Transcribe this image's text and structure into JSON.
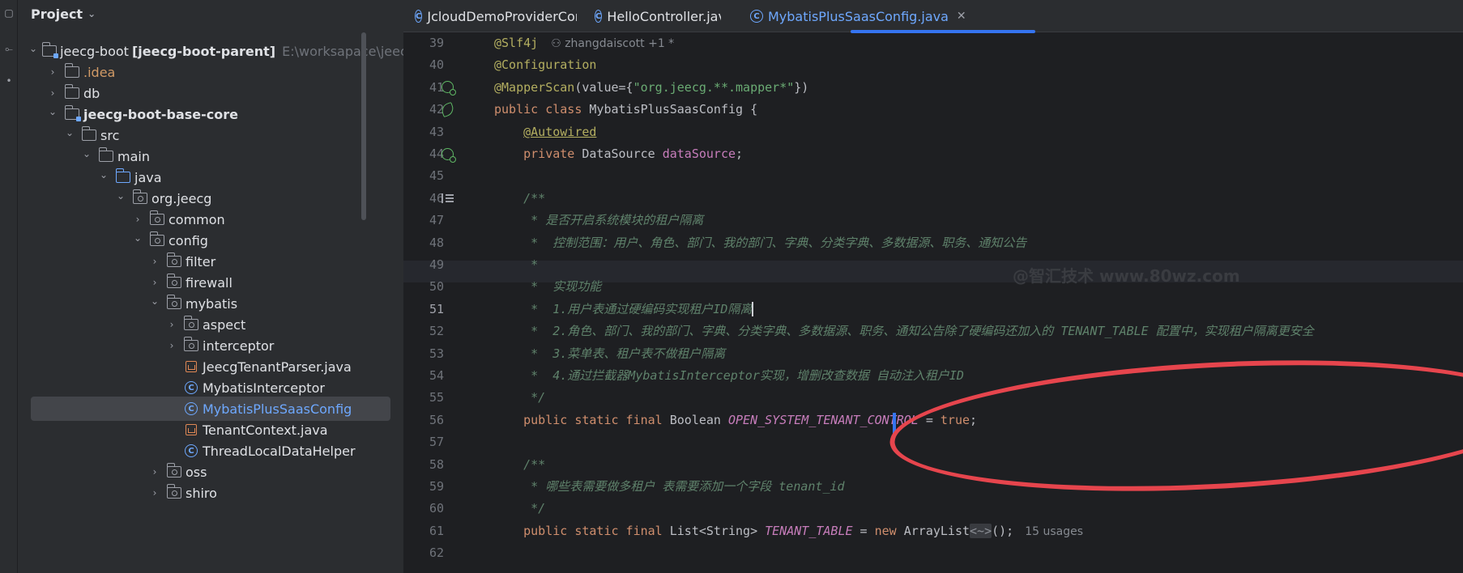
{
  "project_panel": {
    "title": "Project",
    "tree": [
      {
        "label": "jeecg-boot",
        "suffix": "[jeecg-boot-parent]",
        "path": "E:\\worksapace\\jeecg\\je",
        "icon": "module-folder-icon",
        "depth": 1,
        "expanded": true
      },
      {
        "label": ".idea",
        "icon": "folder-icon",
        "depth": 2,
        "expanded": false,
        "color": "orange"
      },
      {
        "label": "db",
        "icon": "folder-icon",
        "depth": 2,
        "expanded": false
      },
      {
        "label": "jeecg-boot-base-core",
        "icon": "module-folder-icon",
        "depth": 2,
        "expanded": true,
        "bold": true
      },
      {
        "label": "src",
        "icon": "folder-icon",
        "depth": 3,
        "expanded": true
      },
      {
        "label": "main",
        "icon": "folder-icon",
        "depth": 4,
        "expanded": true
      },
      {
        "label": "java",
        "icon": "source-folder-icon",
        "depth": 5,
        "expanded": true
      },
      {
        "label": "org.jeecg",
        "icon": "package-icon",
        "depth": 6,
        "expanded": true
      },
      {
        "label": "common",
        "icon": "package-icon",
        "depth": 7,
        "expanded": false
      },
      {
        "label": "config",
        "icon": "package-icon",
        "depth": 7,
        "expanded": true
      },
      {
        "label": "filter",
        "icon": "package-icon",
        "depth": 8,
        "expanded": false
      },
      {
        "label": "firewall",
        "icon": "package-icon",
        "depth": 8,
        "expanded": false
      },
      {
        "label": "mybatis",
        "icon": "package-icon",
        "depth": 8,
        "expanded": true
      },
      {
        "label": "aspect",
        "icon": "package-icon",
        "depth": 9,
        "expanded": false
      },
      {
        "label": "interceptor",
        "icon": "package-icon",
        "depth": 9,
        "expanded": false
      },
      {
        "label": "JeecgTenantParser.java",
        "icon": "java-file-icon",
        "depth": 9
      },
      {
        "label": "MybatisInterceptor",
        "icon": "class-icon",
        "depth": 9
      },
      {
        "label": "MybatisPlusSaasConfig",
        "icon": "class-icon",
        "depth": 9,
        "selected": true,
        "color": "blue"
      },
      {
        "label": "TenantContext.java",
        "icon": "java-file-icon",
        "depth": 9
      },
      {
        "label": "ThreadLocalDataHelper",
        "icon": "class-icon",
        "depth": 9
      },
      {
        "label": "oss",
        "icon": "package-icon",
        "depth": 8,
        "expanded": false
      },
      {
        "label": "shiro",
        "icon": "package-icon",
        "depth": 8,
        "expanded": false
      }
    ]
  },
  "tabs": [
    {
      "label": "JcloudDemoProviderController.java",
      "active": false
    },
    {
      "label": "HelloController.java",
      "active": false
    },
    {
      "label": "MybatisPlusSaasConfig.java",
      "active": true,
      "close": "✕"
    }
  ],
  "editor": {
    "current_line": 51,
    "author_hint": "zhangdaiscott +1 *",
    "usages_hint": "15 usages",
    "watermark": "@智汇技术 www.80wz.com",
    "lines": [
      {
        "n": 39,
        "segments": [
          [
            "ann",
            "@Slf4j"
          ]
        ],
        "author": true
      },
      {
        "n": 40,
        "segments": [
          [
            "ann",
            "@Configuration"
          ]
        ]
      },
      {
        "n": 41,
        "segments": [
          [
            "ann",
            "@MapperScan"
          ],
          [
            "plain",
            "(value={"
          ],
          [
            "str",
            "\"org.jeecg.**.mapper*\""
          ],
          [
            "plain",
            "})"
          ]
        ],
        "gutter": "bean-icon"
      },
      {
        "n": 42,
        "segments": [
          [
            "kw",
            "public class "
          ],
          [
            "plain",
            "MybatisPlusSaasConfig {"
          ]
        ],
        "gutter": "spring-leaf-icon"
      },
      {
        "n": 43,
        "segments": [
          [
            "plain",
            "    "
          ],
          [
            "ann",
            "@Autowired"
          ]
        ],
        "underline": true
      },
      {
        "n": 44,
        "segments": [
          [
            "plain",
            "    "
          ],
          [
            "kw",
            "private "
          ],
          [
            "plain",
            "DataSource "
          ],
          [
            "fld",
            "dataSource"
          ],
          [
            "plain",
            ";"
          ]
        ],
        "gutter": "bean-icon"
      },
      {
        "n": 45,
        "segments": []
      },
      {
        "n": 46,
        "segments": [
          [
            "cmt",
            "    /**"
          ]
        ],
        "gutter": "doc-icon"
      },
      {
        "n": 47,
        "segments": [
          [
            "cmt",
            "     * 是否开启系统模块的租户隔离"
          ]
        ]
      },
      {
        "n": 48,
        "segments": [
          [
            "cmt",
            "     *  控制范围：用户、角色、部门、我的部门、字典、分类字典、多数据源、职务、通知公告"
          ]
        ]
      },
      {
        "n": 49,
        "segments": [
          [
            "cmt",
            "     *"
          ]
        ]
      },
      {
        "n": 50,
        "segments": [
          [
            "cmt",
            "     *  实现功能"
          ]
        ]
      },
      {
        "n": 51,
        "segments": [
          [
            "cmt",
            "     *  1.用户表通过硬编码实现租户ID隔离"
          ]
        ],
        "caret": true
      },
      {
        "n": 52,
        "segments": [
          [
            "cmt",
            "     *  2.角色、部门、我的部门、字典、分类字典、多数据源、职务、通知公告除了硬编码还加入的 TENANT_TABLE 配置中，实现租户隔离更安全"
          ]
        ]
      },
      {
        "n": 53,
        "segments": [
          [
            "cmt",
            "     *  3.菜单表、租户表不做租户隔离"
          ]
        ]
      },
      {
        "n": 54,
        "segments": [
          [
            "cmt",
            "     *  4.通过拦截器MybatisInterceptor实现，增删改查数据 自动注入租户ID"
          ]
        ]
      },
      {
        "n": 55,
        "segments": [
          [
            "cmt",
            "     */"
          ]
        ]
      },
      {
        "n": 56,
        "segments": [
          [
            "plain",
            "    "
          ],
          [
            "kw",
            "public static final "
          ],
          [
            "plain",
            "Boolean "
          ],
          [
            "sfld",
            "OPEN_SYSTEM_TENANT_CONTROL"
          ],
          [
            "plain",
            " = "
          ],
          [
            "kw",
            "true"
          ],
          [
            "plain",
            ";"
          ]
        ]
      },
      {
        "n": 57,
        "segments": []
      },
      {
        "n": 58,
        "segments": [
          [
            "cmt",
            "    /**"
          ]
        ]
      },
      {
        "n": 59,
        "segments": [
          [
            "cmt",
            "     * 哪些表需要做多租户 表需要添加一个字段 tenant_id"
          ]
        ]
      },
      {
        "n": 60,
        "segments": [
          [
            "cmt",
            "     */"
          ]
        ]
      },
      {
        "n": 61,
        "segments": [
          [
            "plain",
            "    "
          ],
          [
            "kw",
            "public static final "
          ],
          [
            "plain",
            "List<String> "
          ],
          [
            "sfld",
            "TENANT_TABLE"
          ],
          [
            "plain",
            " = "
          ],
          [
            "kw",
            "new "
          ],
          [
            "plain",
            "ArrayList"
          ],
          [
            "generic",
            "<~>"
          ],
          [
            "plain",
            "();"
          ]
        ],
        "usages": true
      },
      {
        "n": 62,
        "segments": []
      }
    ]
  },
  "colors": {
    "annotation_ellipse": "#e6454d",
    "accent": "#3574f0",
    "keyword": "#cf8e6d",
    "string": "#6aab73",
    "comment": "#5f826b",
    "field": "#c77dbb"
  }
}
